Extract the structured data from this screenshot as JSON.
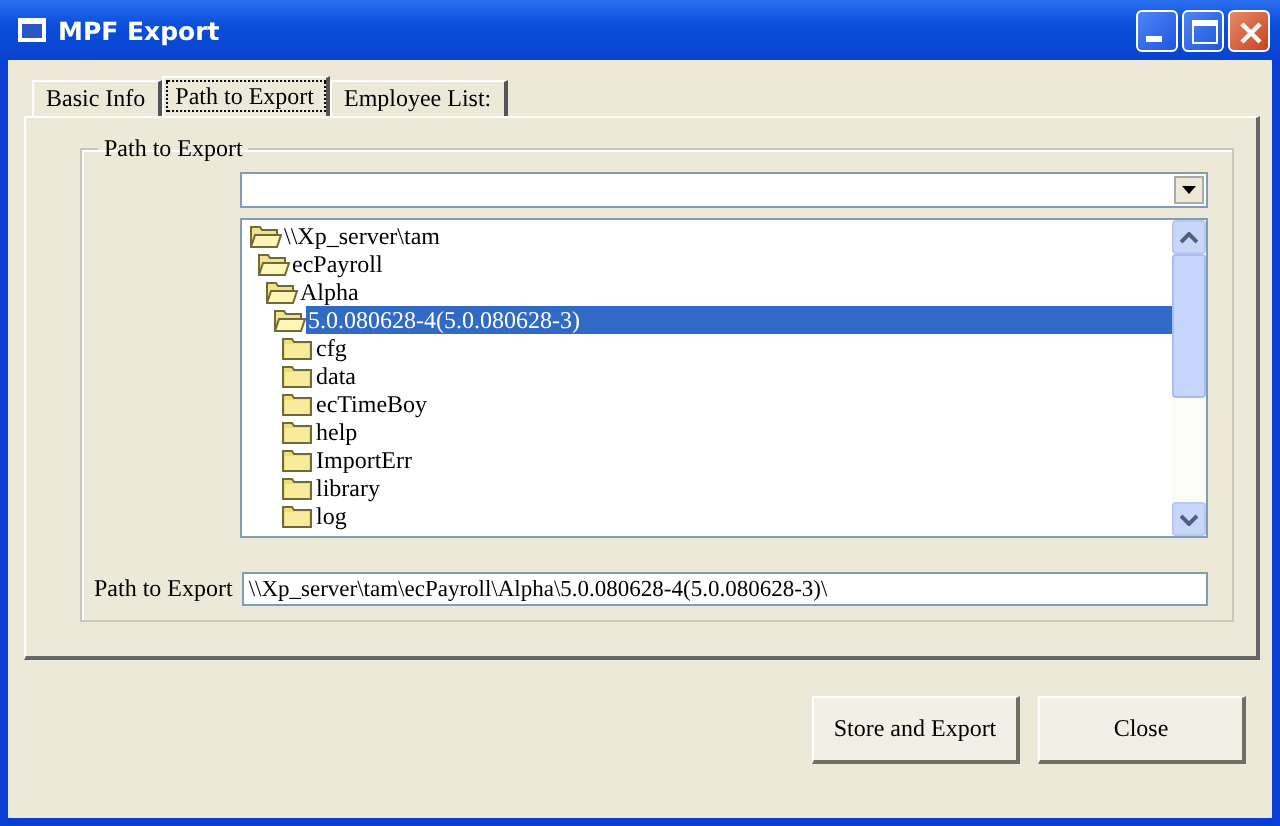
{
  "window": {
    "title": "MPF Export"
  },
  "tabs": [
    {
      "label": "Basic Info",
      "selected": false
    },
    {
      "label": "Path to Export",
      "selected": true
    },
    {
      "label": "Employee List:",
      "selected": false
    }
  ],
  "group": {
    "title": "Path to Export"
  },
  "tree": [
    {
      "label": "\\\\Xp_server\\tam",
      "expanded": true,
      "selected": false,
      "children": [
        {
          "label": "ecPayroll",
          "expanded": true,
          "selected": false,
          "children": [
            {
              "label": "Alpha",
              "expanded": true,
              "selected": false,
              "children": [
                {
                  "label": "5.0.080628-4(5.0.080628-3)",
                  "expanded": true,
                  "selected": true,
                  "children": [
                    {
                      "label": "cfg",
                      "expanded": false,
                      "selected": false
                    },
                    {
                      "label": "data",
                      "expanded": false,
                      "selected": false
                    },
                    {
                      "label": "ecTimeBoy",
                      "expanded": false,
                      "selected": false
                    },
                    {
                      "label": "help",
                      "expanded": false,
                      "selected": false
                    },
                    {
                      "label": "ImportErr",
                      "expanded": false,
                      "selected": false
                    },
                    {
                      "label": "library",
                      "expanded": false,
                      "selected": false
                    },
                    {
                      "label": "log",
                      "expanded": false,
                      "selected": false
                    }
                  ]
                }
              ]
            }
          ]
        }
      ]
    }
  ],
  "path_field": {
    "label": "Path to Export",
    "value": "\\\\Xp_server\\tam\\ecPayroll\\Alpha\\5.0.080628-4(5.0.080628-3)\\"
  },
  "buttons": [
    {
      "label": "Store and Export"
    },
    {
      "label": "Close"
    }
  ]
}
